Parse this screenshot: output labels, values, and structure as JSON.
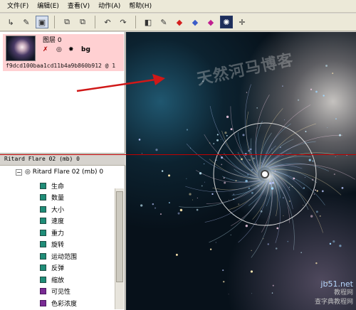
{
  "menu": [
    "文件(F)",
    "编辑(E)",
    "查看(V)",
    "动作(A)",
    "帮助(H)"
  ],
  "toolbar": {
    "buttons": [
      {
        "name": "new-icon",
        "glyph": "↳"
      },
      {
        "name": "open-icon",
        "glyph": "✎"
      },
      {
        "name": "save-icon",
        "glyph": "▣"
      },
      {
        "name": "copy-icon",
        "glyph": "⧉"
      },
      {
        "name": "paste-icon",
        "glyph": "⧉"
      },
      {
        "name": "undo-icon",
        "glyph": "↶"
      },
      {
        "name": "redo-icon",
        "glyph": "↷"
      },
      {
        "name": "layer-icon",
        "glyph": "◧"
      },
      {
        "name": "pen-icon",
        "glyph": "✎"
      },
      {
        "name": "red-flag-icon",
        "glyph": "◆"
      },
      {
        "name": "blue-layer-icon",
        "glyph": "◆"
      },
      {
        "name": "magenta-layer-icon",
        "glyph": "◆"
      },
      {
        "name": "particle-icon",
        "glyph": "✺"
      },
      {
        "name": "grid-icon",
        "glyph": "✛"
      }
    ],
    "colors": {
      "red-flag-icon": "#d42020",
      "blue-layer-icon": "#3b5cc8",
      "magenta-layer-icon": "#c02090"
    }
  },
  "layer": {
    "name": "图层 0",
    "id_text": "f9dcd100baa1cd11b4a9b860b912   @ 1",
    "icons": [
      "x-icon",
      "target-icon",
      "gear-icon"
    ],
    "bg_label": "bg"
  },
  "tree": {
    "header": "Ritard Flare 02 (mb) 0",
    "root_label": "Ritard Flare 02 (mb) 0",
    "items": [
      {
        "label": "生命",
        "color": "teal"
      },
      {
        "label": "数量",
        "color": "teal"
      },
      {
        "label": "大小",
        "color": "teal"
      },
      {
        "label": "速度",
        "color": "teal"
      },
      {
        "label": "重力",
        "color": "teal"
      },
      {
        "label": "旋转",
        "color": "teal"
      },
      {
        "label": "运动范围",
        "color": "teal"
      },
      {
        "label": "反弹",
        "color": "teal"
      },
      {
        "label": "缩放",
        "color": "teal"
      },
      {
        "label": "可见性",
        "color": "purple"
      },
      {
        "label": "色彩浓度",
        "color": "purple"
      }
    ]
  },
  "canvas": {
    "watermark": "天然河马博客",
    "corner_watermark": [
      "jb51.net",
      "教程网",
      "查字典教程网"
    ]
  }
}
